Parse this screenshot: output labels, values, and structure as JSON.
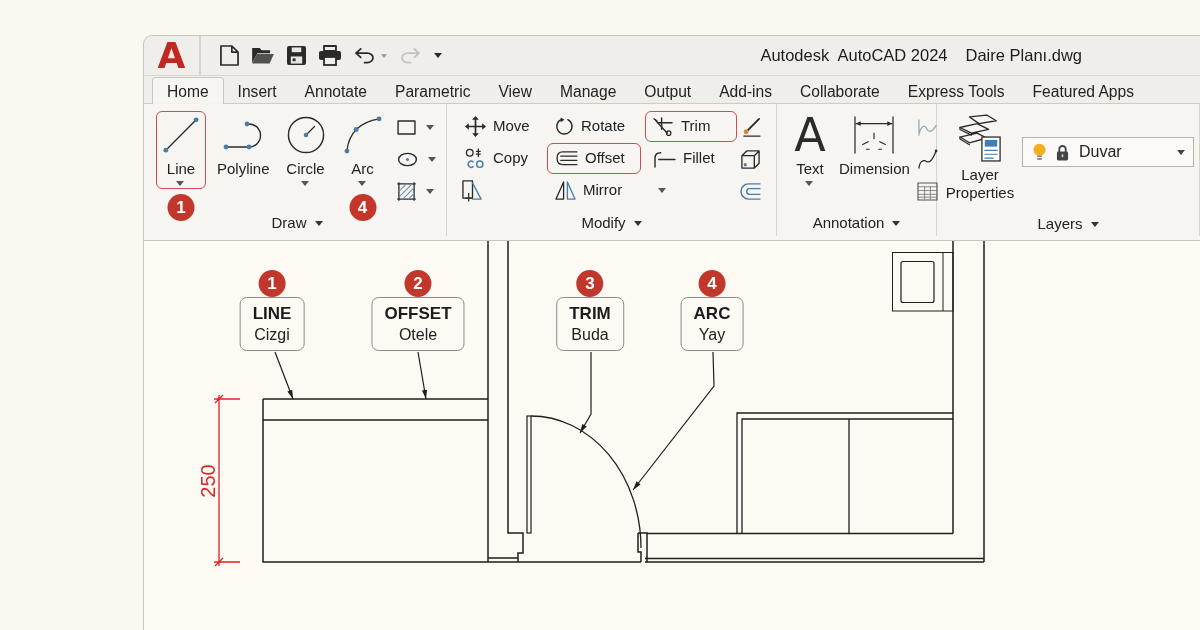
{
  "window": {
    "logo": "A",
    "app_name": "Autodesk  AutoCAD 2024",
    "file_name": "Daire Planı.dwg"
  },
  "quick_access": [
    {
      "kind": "new",
      "disabled": false,
      "dropdown": false
    },
    {
      "kind": "open",
      "disabled": false,
      "dropdown": false
    },
    {
      "kind": "save",
      "disabled": false,
      "dropdown": false
    },
    {
      "kind": "print",
      "disabled": false,
      "dropdown": false
    },
    {
      "kind": "undo",
      "disabled": false,
      "dropdown": true
    },
    {
      "kind": "redo",
      "disabled": true,
      "dropdown": false
    },
    {
      "kind": "menu",
      "disabled": false,
      "dropdown": false
    }
  ],
  "tabs": [
    {
      "label": "Home",
      "selected": true
    },
    {
      "label": "Insert",
      "selected": false
    },
    {
      "label": "Annotate",
      "selected": false
    },
    {
      "label": "Parametric",
      "selected": false
    },
    {
      "label": "View",
      "selected": false
    },
    {
      "label": "Manage",
      "selected": false
    },
    {
      "label": "Output",
      "selected": false
    },
    {
      "label": "Add-ins",
      "selected": false
    },
    {
      "label": "Collaborate",
      "selected": false
    },
    {
      "label": "Express Tools",
      "selected": false
    },
    {
      "label": "Featured Apps",
      "selected": false
    }
  ],
  "ribbon": {
    "panels": [
      {
        "title": "Draw",
        "kind": "large",
        "tools": [
          {
            "kind": "line",
            "label": "Line",
            "highlighted": true,
            "dropdown": true,
            "badge": "1"
          },
          {
            "kind": "polyline",
            "label": "Polyline",
            "highlighted": false,
            "dropdown": false
          },
          {
            "kind": "circle",
            "label": "Circle",
            "highlighted": false,
            "dropdown": true
          },
          {
            "kind": "arc",
            "label": "Arc",
            "highlighted": false,
            "dropdown": true,
            "badge": "4"
          }
        ],
        "small_tools": [
          {
            "kind": "rectangle",
            "dropdown": true
          },
          {
            "kind": "ellipse",
            "dropdown": true
          },
          {
            "kind": "hatch",
            "dropdown": true
          }
        ]
      },
      {
        "title": "Modify",
        "kind": "grid",
        "tools": [
          {
            "kind": "move",
            "label": "Move",
            "highlighted": false
          },
          {
            "kind": "rotate",
            "label": "Rotate",
            "highlighted": false
          },
          {
            "kind": "trim",
            "label": "Trim",
            "highlighted": true
          },
          {
            "kind": "copy",
            "label": "Copy",
            "highlighted": false
          },
          {
            "kind": "offset",
            "label": "Offset",
            "highlighted": true
          },
          {
            "kind": "fillet",
            "label": "Fillet",
            "highlighted": false
          },
          {
            "kind": "stretch",
            "highlighted": false
          },
          {
            "kind": "mirror",
            "label": "Mirror",
            "highlighted": false
          },
          {
            "kind": "more",
            "highlighted": false
          }
        ],
        "small_tools": [
          {
            "kind": "erase"
          },
          {
            "kind": "array"
          },
          {
            "kind": "offsetcurve"
          }
        ]
      },
      {
        "title": "Annotation",
        "kind": "large",
        "tools": [
          {
            "kind": "text",
            "glyph": "A",
            "label": "Text",
            "highlighted": false,
            "dropdown": true
          },
          {
            "kind": "dimension",
            "label": "Dimension",
            "highlighted": false,
            "dropdown": false
          }
        ],
        "small_tools": [
          {
            "kind": "leader"
          },
          {
            "kind": "spline"
          },
          {
            "kind": "table"
          }
        ]
      },
      {
        "title": "Layers",
        "kind": "large",
        "tools": [
          {
            "kind": "layers",
            "label": "Layer Properties",
            "highlighted": false,
            "dropdown": false
          }
        ],
        "layer_control": {
          "value": "Duvar",
          "bulb_on": true,
          "locked": true
        }
      }
    ]
  },
  "canvas": {
    "dimension": "250",
    "callouts": [
      {
        "number": "1",
        "command": "LINE",
        "translation": "Cizgi"
      },
      {
        "number": "2",
        "command": "OFFSET",
        "translation": "Otele"
      },
      {
        "number": "3",
        "command": "TRIM",
        "translation": "Buda"
      },
      {
        "number": "4",
        "command": "ARC",
        "translation": "Yay"
      }
    ]
  }
}
